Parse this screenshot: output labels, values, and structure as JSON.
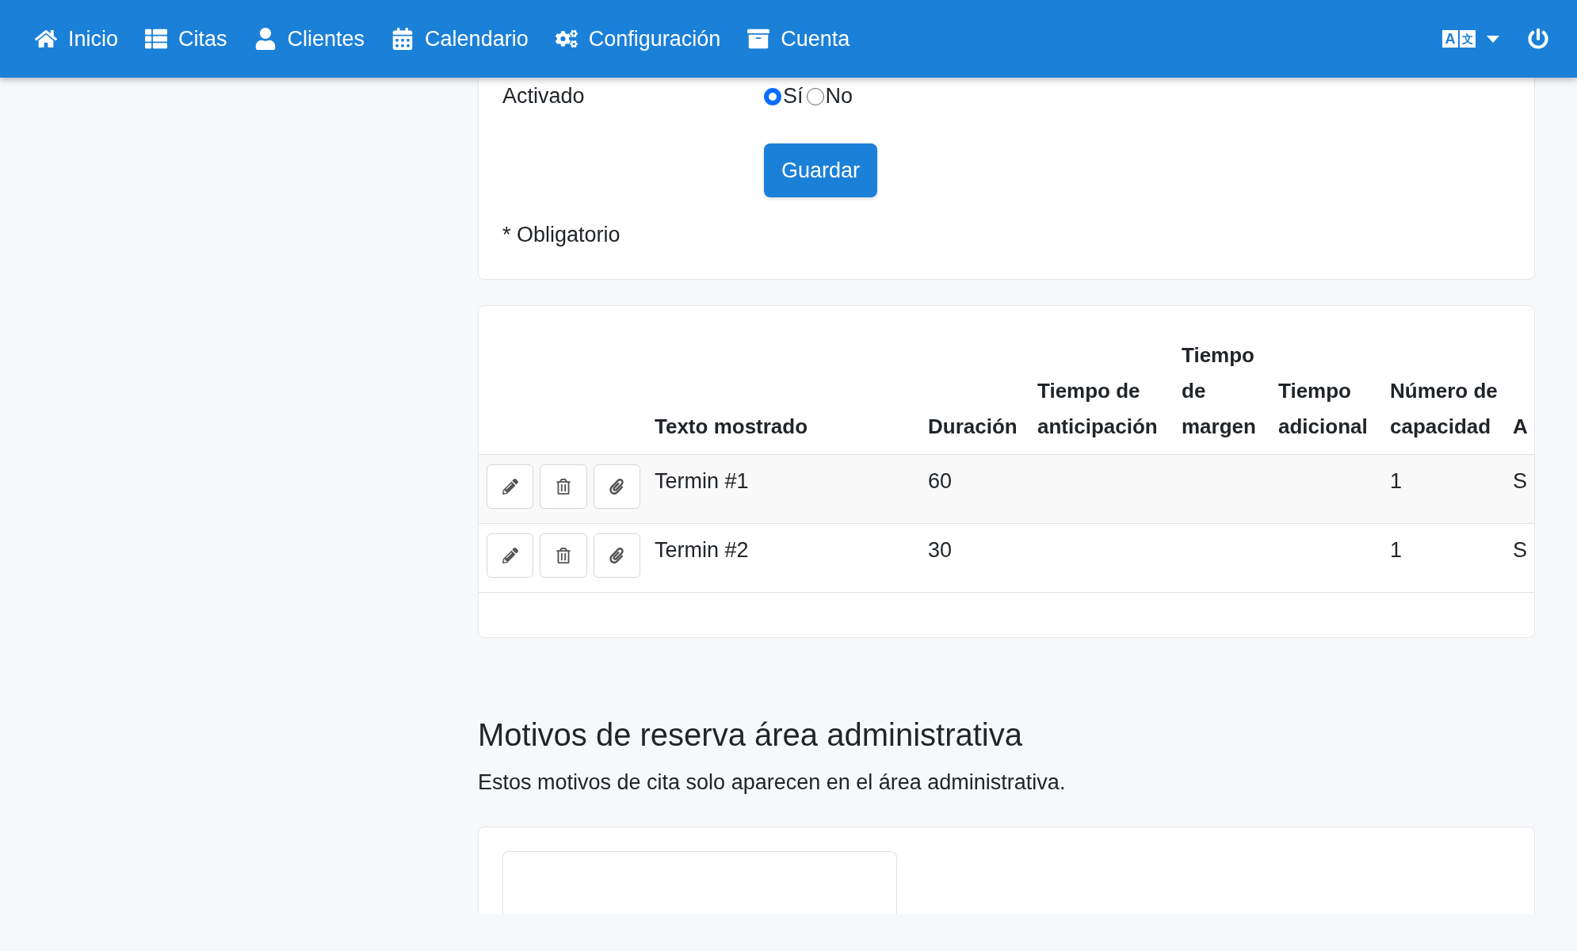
{
  "navbar": {
    "items": [
      {
        "kind": "home",
        "label": "Inicio"
      },
      {
        "kind": "list",
        "label": "Citas"
      },
      {
        "kind": "user",
        "label": "Clientes"
      },
      {
        "kind": "calendar",
        "label": "Calendario"
      },
      {
        "kind": "cogs",
        "label": "Configuración"
      },
      {
        "kind": "archive",
        "label": "Cuenta"
      }
    ]
  },
  "language_button": {
    "glyphs": [
      "A",
      "文"
    ]
  },
  "form": {
    "activado": {
      "label": "Activado",
      "options": [
        {
          "label": "Sí",
          "selected": true
        },
        {
          "label": "No",
          "selected": false
        }
      ]
    },
    "save_button": "Guardar",
    "required_note": "* Obligatorio"
  },
  "table": {
    "columns": [
      "Texto mostrado",
      "Duración",
      "Tiempo de anticipación",
      "Tiempo de margen",
      "Tiempo adicional",
      "Número de capacidad",
      "A"
    ],
    "rows": [
      {
        "cells": [
          "Termin #1",
          "60",
          "",
          "",
          "",
          "1",
          "S"
        ]
      },
      {
        "cells": [
          "Termin #2",
          "30",
          "",
          "",
          "",
          "1",
          "S"
        ]
      }
    ]
  },
  "admin_section": {
    "title": "Motivos de reserva área administrativa",
    "description": "Estos motivos de cita solo aparecen en el área administrativa."
  }
}
